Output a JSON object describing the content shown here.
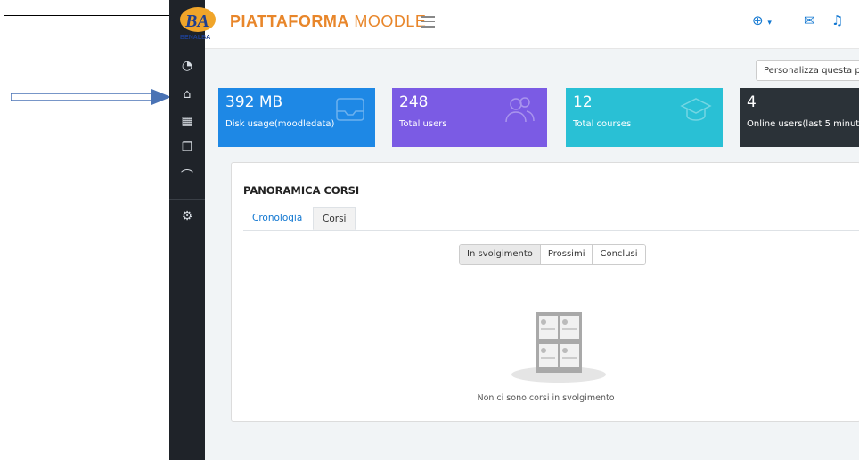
{
  "header": {
    "brand_bold": "PIATTAFORMA",
    "brand_light": "MOODLE",
    "logo_text": "BENALBA"
  },
  "toolbar": {
    "customize_label": "Personalizza questa p"
  },
  "cards": [
    {
      "value": "392 MB",
      "label": "Disk usage(moodledata)",
      "color": "#1e88e5",
      "icon": "inbox-icon"
    },
    {
      "value": "248",
      "label": "Total users",
      "color": "#7b5be4",
      "icon": "users-icon"
    },
    {
      "value": "12",
      "label": "Total courses",
      "color": "#29c0d5",
      "icon": "graduation-cap-icon"
    },
    {
      "value": "4",
      "label": "Online users(last 5 minut",
      "color": "#2b3238",
      "icon": "online-icon"
    }
  ],
  "panel": {
    "title": "PANORAMICA CORSI",
    "tabs": [
      "Cronologia",
      "Corsi"
    ],
    "filters": [
      "In svolgimento",
      "Prossimi",
      "Conclusi"
    ],
    "empty_message": "Non ci sono corsi in svolgimento"
  },
  "colors": {
    "accent": "#1177d1",
    "brand": "#e8862a",
    "sidebar": "#1f2329"
  }
}
